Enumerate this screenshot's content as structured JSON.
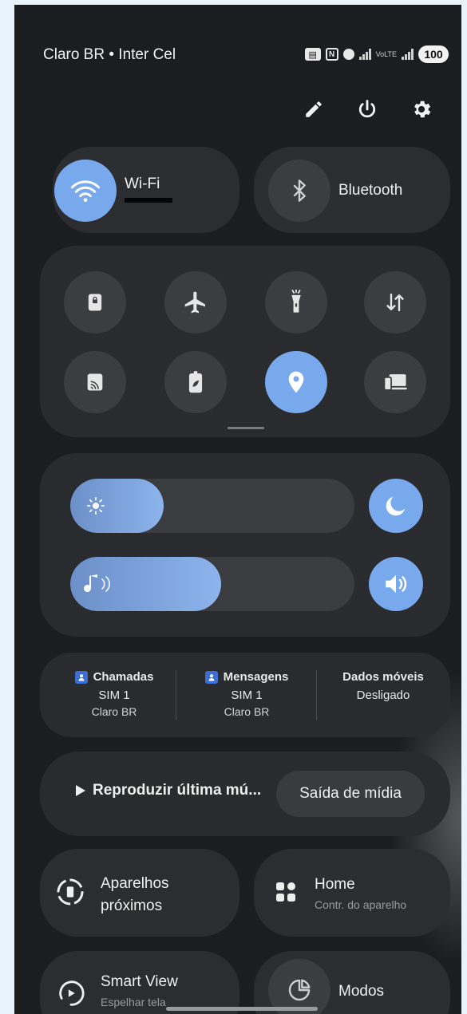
{
  "status_bar": {
    "carrier": "Claro BR • Inter Cel",
    "sim2_label": "VoLTE",
    "battery": "100"
  },
  "top_actions": {
    "edit": "pencil-icon",
    "power": "power-icon",
    "settings": "gear-icon"
  },
  "big_tiles": {
    "wifi": {
      "label": "Wi-Fi",
      "active": true
    },
    "bluetooth": {
      "label": "Bluetooth",
      "active": false
    }
  },
  "quick_tiles": [
    {
      "name": "lock-screen",
      "icon": "lock-icon",
      "active": false
    },
    {
      "name": "airplane-mode",
      "icon": "airplane-icon",
      "active": false
    },
    {
      "name": "flashlight",
      "icon": "flashlight-icon",
      "active": false
    },
    {
      "name": "mobile-data",
      "icon": "data-arrows-icon",
      "active": false
    },
    {
      "name": "cast",
      "icon": "cast-icon",
      "active": false
    },
    {
      "name": "power-saving",
      "icon": "battery-leaf-icon",
      "active": false
    },
    {
      "name": "location",
      "icon": "location-icon",
      "active": true
    },
    {
      "name": "device-link",
      "icon": "devices-icon",
      "active": false
    }
  ],
  "sliders": {
    "brightness": {
      "level_percent": 33
    },
    "volume": {
      "level_percent": 53
    }
  },
  "sim": {
    "calls": {
      "title": "Chamadas",
      "sim": "SIM 1",
      "carrier": "Claro BR"
    },
    "messages": {
      "title": "Mensagens",
      "sim": "SIM 1",
      "carrier": "Claro BR"
    },
    "mobile_data": {
      "title": "Dados móveis",
      "value": "Desligado"
    }
  },
  "media": {
    "play_label": "Reproduzir última mú...",
    "output_label": "Saída de mídia"
  },
  "bottom_tiles": {
    "nearby": {
      "label_line1": "Aparelhos",
      "label_line2": "próximos"
    },
    "home": {
      "label": "Home",
      "sub": "Contr. do aparelho"
    },
    "smart_view": {
      "label": "Smart View",
      "sub": "Espelhar tela"
    },
    "modes": {
      "label": "Modos"
    }
  },
  "colors": {
    "accent": "#78a9ec",
    "panel": "#2a2b2e",
    "background": "#1c1d20"
  }
}
